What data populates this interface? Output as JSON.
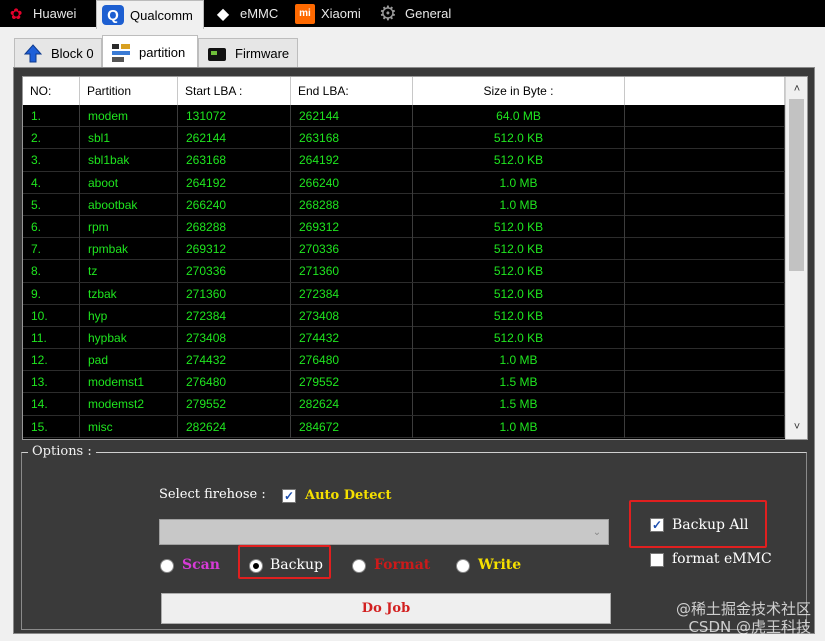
{
  "brand_tabs": [
    {
      "label": "Huawei",
      "icon": "huawei-logo-icon"
    },
    {
      "label": "Qualcomm",
      "icon": "qualcomm-logo-icon",
      "active": true
    },
    {
      "label": "eMMC",
      "icon": "emmc-diamond-icon"
    },
    {
      "label": "Xiaomi",
      "icon": "xiaomi-logo-icon"
    },
    {
      "label": "General",
      "icon": "gear-icon"
    }
  ],
  "sub_tabs": [
    {
      "label": "Block 0",
      "icon": "upload-arrow-icon"
    },
    {
      "label": "partition",
      "icon": "partition-icon",
      "active": true
    },
    {
      "label": "Firmware",
      "icon": "chip-icon"
    }
  ],
  "table": {
    "headers": [
      "NO:",
      "Partition",
      "Start LBA :",
      "End LBA:",
      "Size in Byte :",
      ""
    ],
    "rows": [
      [
        "1.",
        "modem",
        "131072",
        "262144",
        "64.0 MB"
      ],
      [
        "2.",
        "sbl1",
        "262144",
        "263168",
        "512.0 KB"
      ],
      [
        "3.",
        "sbl1bak",
        "263168",
        "264192",
        "512.0 KB"
      ],
      [
        "4.",
        "aboot",
        "264192",
        "266240",
        "1.0 MB"
      ],
      [
        "5.",
        "abootbak",
        "266240",
        "268288",
        "1.0 MB"
      ],
      [
        "6.",
        "rpm",
        "268288",
        "269312",
        "512.0 KB"
      ],
      [
        "7.",
        "rpmbak",
        "269312",
        "270336",
        "512.0 KB"
      ],
      [
        "8.",
        "tz",
        "270336",
        "271360",
        "512.0 KB"
      ],
      [
        "9.",
        "tzbak",
        "271360",
        "272384",
        "512.0 KB"
      ],
      [
        "10.",
        "hyp",
        "272384",
        "273408",
        "512.0 KB"
      ],
      [
        "11.",
        "hypbak",
        "273408",
        "274432",
        "512.0 KB"
      ],
      [
        "12.",
        "pad",
        "274432",
        "276480",
        "1.0 MB"
      ],
      [
        "13.",
        "modemst1",
        "276480",
        "279552",
        "1.5 MB"
      ],
      [
        "14.",
        "modemst2",
        "279552",
        "282624",
        "1.5 MB"
      ],
      [
        "15.",
        "misc",
        "282624",
        "284672",
        "1.0 MB"
      ]
    ],
    "scroll_up": "˄",
    "scroll_down": "˅"
  },
  "options": {
    "legend": "Options :",
    "select_firehose_label": "Select firehose :",
    "auto_detect_label": "Auto Detect",
    "auto_detect_checked": true,
    "firehose_value": "",
    "radios": {
      "scan": "Scan",
      "backup": "Backup",
      "format": "Format",
      "write": "Write",
      "selected": "backup"
    },
    "backup_all_label": "Backup All",
    "backup_all_checked": true,
    "format_emmc_label": "format eMMC",
    "format_emmc_checked": false,
    "do_job_label": "Do Job"
  },
  "colors": {
    "table_text": "#1fe61f",
    "panel_bg": "#3a3a3a",
    "highlight": "#e01f1f",
    "scan": "#d63bd6",
    "format": "#cc1a1a",
    "write": "#f5e000",
    "auto_detect": "#f5e000"
  },
  "watermark": {
    "line1": "@稀土掘金技术社区",
    "line2": "CSDN @虎王科技"
  }
}
